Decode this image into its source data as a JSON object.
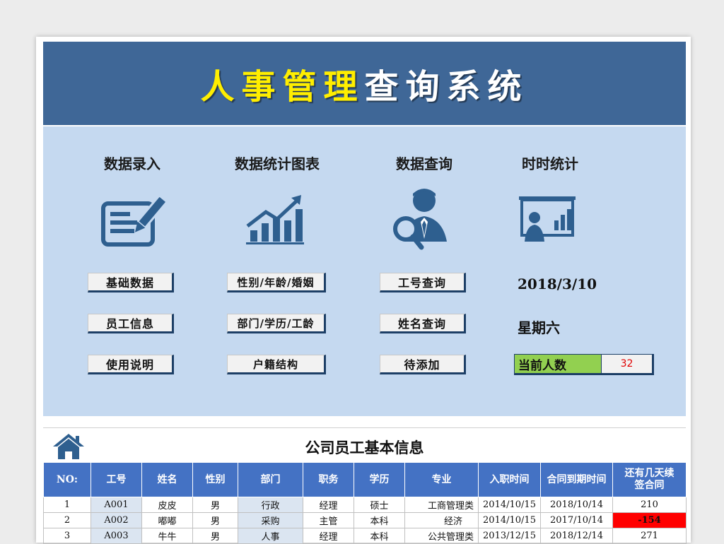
{
  "banner": {
    "title_part1": "人事管理",
    "title_part2": "查询系统"
  },
  "sections": [
    {
      "title": "数据录入",
      "icon": "form-pen-icon"
    },
    {
      "title": "数据统计图表",
      "icon": "chart-growth-icon"
    },
    {
      "title": "数据查询",
      "icon": "person-magnifier-icon"
    },
    {
      "title": "时时统计",
      "icon": "presentation-board-icon"
    }
  ],
  "buttons": {
    "entry": [
      "基础数据",
      "员工信息",
      "使用说明"
    ],
    "stats": [
      "性别/年龄/婚姻",
      "部门/学历/工龄",
      "户籍结构"
    ],
    "query": [
      "工号查询",
      "姓名查询",
      "待添加"
    ]
  },
  "realtime": {
    "date": "2018/3/10",
    "weekday": "星期六",
    "count_label": "当前人数",
    "count_value": "32"
  },
  "table": {
    "title": "公司员工基本信息",
    "home_icon": "home-icon",
    "headers": [
      "NO:",
      "工号",
      "姓名",
      "性别",
      "部门",
      "职务",
      "学历",
      "专业",
      "入职时间",
      "合同到期时间",
      "还有几天续\n签合同"
    ],
    "rows": [
      [
        "1",
        "A001",
        "皮皮",
        "男",
        "行政",
        "经理",
        "硕士",
        "工商管理类",
        "2014/10/15",
        "2018/10/14",
        "210"
      ],
      [
        "2",
        "A002",
        "嘟嘟",
        "男",
        "采购",
        "主管",
        "本科",
        "经济",
        "2014/10/15",
        "2017/10/14",
        "-154"
      ],
      [
        "3",
        "A003",
        "牛牛",
        "男",
        "人事",
        "经理",
        "本科",
        "公共管理类",
        "2013/12/15",
        "2018/12/14",
        "271"
      ]
    ]
  },
  "colors": {
    "banner": "#3f6797",
    "panel": "#c5d9f0",
    "header": "#4472c4",
    "accent_yellow": "#ffee00",
    "count_green": "#92d050",
    "alert_red": "#ff0000"
  }
}
